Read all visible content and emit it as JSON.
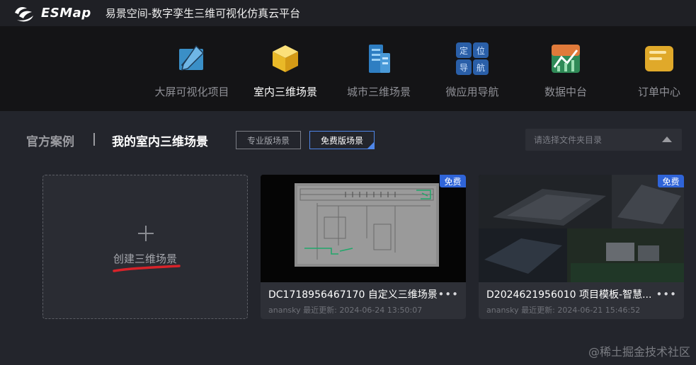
{
  "header": {
    "logo_text": "ESMap",
    "app_title": "易景空间-数字孪生三维可视化仿真云平台"
  },
  "nav": {
    "items": [
      {
        "label": "大屏可视化项目",
        "icon": "dashboard-edit-icon"
      },
      {
        "label": "室内三维场景",
        "icon": "cube-icon"
      },
      {
        "label": "城市三维场景",
        "icon": "buildings-icon"
      },
      {
        "label": "微应用导航",
        "icon": "navigation-grid-icon",
        "glyphs": [
          "定",
          "位",
          "导",
          "航"
        ]
      },
      {
        "label": "数据中台",
        "icon": "chart-icon"
      },
      {
        "label": "订单中心",
        "icon": "order-icon"
      }
    ],
    "active_index": 1
  },
  "tabs": {
    "official": "官方案例",
    "mine": "我的室内三维场景",
    "pro_button": "专业版场景",
    "free_button": "免费版场景",
    "folder_placeholder": "请选择文件夹目录"
  },
  "create": {
    "label": "创建三维场景"
  },
  "scenes": [
    {
      "badge": "免费",
      "name": "DC1718956467170  自定义三维场景",
      "author": "anansky",
      "updated_label": "最近更新:",
      "updated_time": "2024-06-24 13:50:07",
      "more": "•••"
    },
    {
      "badge": "免费",
      "name": "D2024621956010  项目模板-智慧...",
      "author": "anansky",
      "updated_label": "最近更新:",
      "updated_time": "2024-06-21 15:46:52",
      "more": "•••"
    }
  ],
  "watermark": "@稀土掘金技术社区",
  "colors": {
    "accent": "#2f64d8",
    "active_border": "#4f86e8",
    "annotation": "#d8232a"
  }
}
